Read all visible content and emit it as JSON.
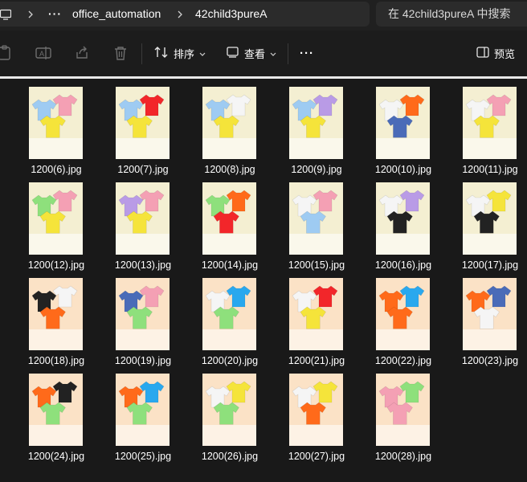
{
  "addressbar": {
    "more_label": "···",
    "breadcrumbs": [
      "office_automation",
      "42child3pureA"
    ]
  },
  "search": {
    "placeholder": "在 42child3pureA 中搜索"
  },
  "commandbar": {
    "sort_label": "排序",
    "view_label": "查看",
    "more_label": "···",
    "preview_label": "预览"
  },
  "files": [
    {
      "name": "1200(6).jpg",
      "bg": "#f4efd2",
      "shirts": [
        "#9ecbf2",
        "#f4a0b4",
        "#f5e43a"
      ]
    },
    {
      "name": "1200(7).jpg",
      "bg": "#f4efd2",
      "shirts": [
        "#9ecbf2",
        "#f2262a",
        "#f5e43a"
      ]
    },
    {
      "name": "1200(8).jpg",
      "bg": "#f4efd2",
      "shirts": [
        "#9ecbf2",
        "#f5f5f5",
        "#f5e43a"
      ]
    },
    {
      "name": "1200(9).jpg",
      "bg": "#f4efd2",
      "shirts": [
        "#9ecbf2",
        "#b99be6",
        "#f5e43a"
      ]
    },
    {
      "name": "1200(10).jpg",
      "bg": "#f4efd2",
      "shirts": [
        "#f5f5f5",
        "#ff6a1a",
        "#4a6bb8"
      ]
    },
    {
      "name": "1200(11).jpg",
      "bg": "#f4efd2",
      "shirts": [
        "#f5f5f5",
        "#f4a0b4",
        "#f5e43a"
      ]
    },
    {
      "name": "1200(12).jpg",
      "bg": "#f4efd2",
      "shirts": [
        "#8ee07c",
        "#f4a0b4",
        "#f5e43a"
      ]
    },
    {
      "name": "1200(13).jpg",
      "bg": "#f4efd2",
      "shirts": [
        "#b99be6",
        "#f4a0b4",
        "#f5e43a"
      ]
    },
    {
      "name": "1200(14).jpg",
      "bg": "#f4efd2",
      "shirts": [
        "#8ee07c",
        "#ff6a1a",
        "#f2262a"
      ]
    },
    {
      "name": "1200(15).jpg",
      "bg": "#f4efd2",
      "shirts": [
        "#f5f5f5",
        "#f4a0b4",
        "#9ecbf2"
      ]
    },
    {
      "name": "1200(16).jpg",
      "bg": "#f4efd2",
      "shirts": [
        "#f5f5f5",
        "#b99be6",
        "#222222"
      ]
    },
    {
      "name": "1200(17).jpg",
      "bg": "#f4efd2",
      "shirts": [
        "#f5f5f5",
        "#f5e43a",
        "#222222"
      ]
    },
    {
      "name": "1200(18).jpg",
      "bg": "#fbe2c6",
      "shirts": [
        "#222222",
        "#f5f5f5",
        "#ff6a1a"
      ]
    },
    {
      "name": "1200(19).jpg",
      "bg": "#fbe2c6",
      "shirts": [
        "#4a6bb8",
        "#f4a0b4",
        "#8ee07c"
      ]
    },
    {
      "name": "1200(20).jpg",
      "bg": "#fbe2c6",
      "shirts": [
        "#f5f5f5",
        "#29a8ee",
        "#8ee07c"
      ]
    },
    {
      "name": "1200(21).jpg",
      "bg": "#fbe2c6",
      "shirts": [
        "#f5f5f5",
        "#f2262a",
        "#f5e43a"
      ]
    },
    {
      "name": "1200(22).jpg",
      "bg": "#fbe2c6",
      "shirts": [
        "#ff6a1a",
        "#29a8ee",
        "#ff6a1a"
      ]
    },
    {
      "name": "1200(23).jpg",
      "bg": "#fbe2c6",
      "shirts": [
        "#ff6a1a",
        "#4a6bb8",
        "#f5f5f5"
      ]
    },
    {
      "name": "1200(24).jpg",
      "bg": "#fbe2c6",
      "shirts": [
        "#ff6a1a",
        "#222222",
        "#8ee07c"
      ]
    },
    {
      "name": "1200(25).jpg",
      "bg": "#fbe2c6",
      "shirts": [
        "#ff6a1a",
        "#29a8ee",
        "#8ee07c"
      ]
    },
    {
      "name": "1200(26).jpg",
      "bg": "#fbe2c6",
      "shirts": [
        "#f5f5f5",
        "#f5e43a",
        "#8ee07c"
      ]
    },
    {
      "name": "1200(27).jpg",
      "bg": "#fbe2c6",
      "shirts": [
        "#f5f5f5",
        "#f5e43a",
        "#ff6a1a"
      ]
    },
    {
      "name": "1200(28).jpg",
      "bg": "#fbe2c6",
      "shirts": [
        "#f4a0b4",
        "#8ee07c",
        "#f4a0b4"
      ]
    }
  ]
}
